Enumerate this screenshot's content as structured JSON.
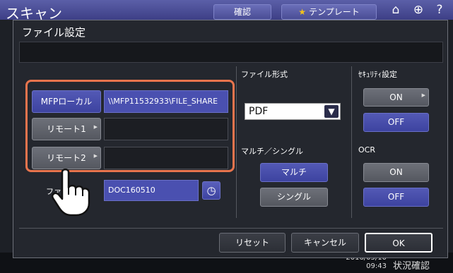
{
  "header": {
    "title": "スキャン",
    "confirm_label": "確認",
    "template_label": "テンプレート",
    "icons": [
      "home-icon",
      "globe-icon",
      "help-icon"
    ]
  },
  "dialog": {
    "title": "ファイル設定",
    "message": "",
    "destinations": {
      "mfp_local_label": "MFPローカル",
      "mfp_local_path": "\\\\MFP11532933\\FILE_SHARE",
      "remote1_label": "リモート1",
      "remote1_value": "",
      "remote2_label": "リモート2",
      "remote2_value": "",
      "file_name_label": "ファイル名",
      "file_name_value": "DOC160510"
    },
    "file_format": {
      "label": "ファイル形式",
      "selected": "PDF"
    },
    "multi_single": {
      "label": "マルチ／シングル",
      "multi_label": "マルチ",
      "single_label": "シングル",
      "selected": "マルチ"
    },
    "security": {
      "label": "ｾｷｭﾘﾃｨ設定",
      "on_label": "ON",
      "off_label": "OFF",
      "selected": "OFF"
    },
    "ocr": {
      "label": "OCR",
      "on_label": "ON",
      "off_label": "OFF",
      "selected": "OFF"
    },
    "footer": {
      "reset_label": "リセット",
      "cancel_label": "キャンセル",
      "ok_label": "OK"
    }
  },
  "status_bar": {
    "date": "2016/05/10",
    "time": "09:43",
    "status_label": "状況確認"
  },
  "colors": {
    "accent": "#4a50b0",
    "highlight": "#e8744d"
  }
}
